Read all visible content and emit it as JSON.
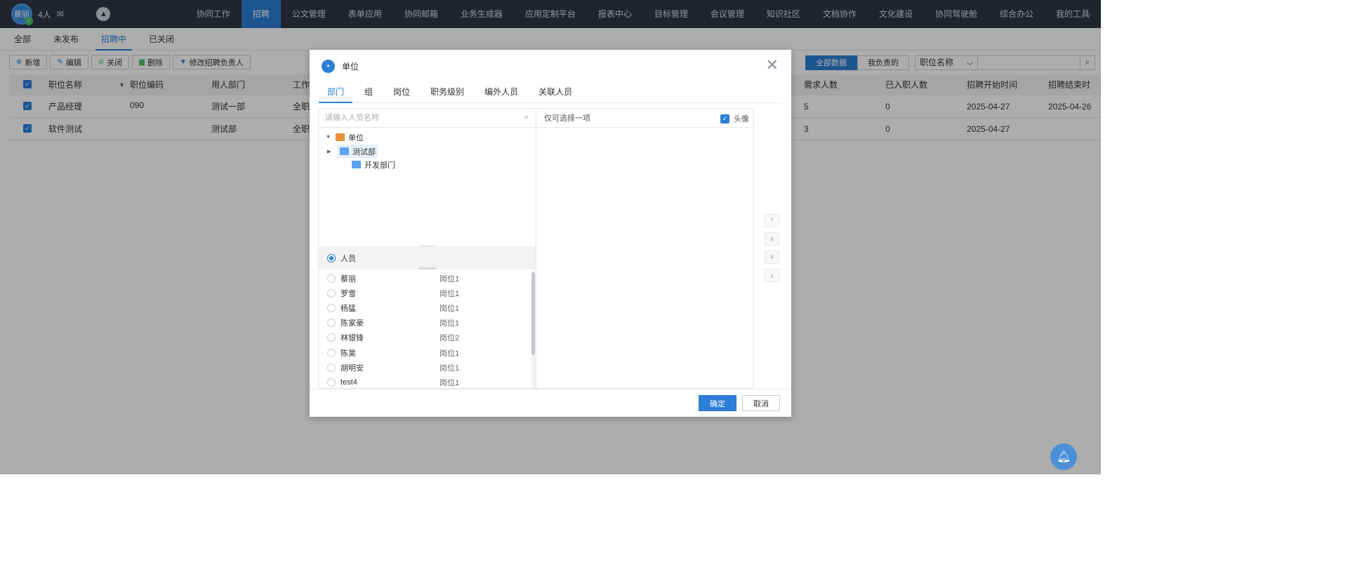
{
  "user": {
    "avatar_text": "蔡丽",
    "count": "4人",
    "mail_icon": "mail-icon"
  },
  "nav": {
    "items": [
      "协同工作",
      "招聘",
      "公文管理",
      "表单应用",
      "协同邮箱",
      "业务生成器",
      "应用定制平台",
      "报表中心",
      "目标管理",
      "会议管理",
      "知识社区",
      "文档协作",
      "文化建设",
      "协同驾驶舱",
      "综合办公",
      "我的工具"
    ],
    "active": "招聘"
  },
  "subtabs": {
    "items": [
      "全部",
      "未发布",
      "招聘中",
      "已关闭"
    ],
    "active": "招聘中"
  },
  "toolbar": {
    "add": "新增",
    "edit": "编辑",
    "close": "关闭",
    "delete": "删除",
    "change_owner": "修改招聘负责人",
    "all_data": "全部数据",
    "mine": "我负责的",
    "field_select": "职位名称",
    "search_value": ""
  },
  "table": {
    "headers": [
      "职位名称",
      "职位编码",
      "用人部门",
      "工作",
      "需求人数",
      "已入职人数",
      "招聘开始时间",
      "招聘结束时"
    ],
    "rows": [
      {
        "name": "产品经理",
        "code": "090",
        "dept": "测试一部",
        "work": "全职",
        "need": "5",
        "joined": "0",
        "start": "2025-04-27",
        "end": "2025-04-26"
      },
      {
        "name": "软件测试",
        "code": "",
        "dept": "测试部",
        "work": "全职",
        "need": "3",
        "joined": "0",
        "start": "2025-04-27",
        "end": ""
      }
    ]
  },
  "modal": {
    "title": "单位",
    "tabs": [
      "部门",
      "组",
      "岗位",
      "职务级别",
      "编外人员",
      "关联人员"
    ],
    "active_tab": "部门",
    "search_placeholder": "请输入人员名称",
    "tree": {
      "root": "单位",
      "children": [
        "测试部",
        "开发部门"
      ],
      "selected": "测试部"
    },
    "person_option": "人员",
    "people": [
      {
        "name": "蔡丽",
        "position": "岗位1"
      },
      {
        "name": "罗雪",
        "position": "岗位1"
      },
      {
        "name": "杨猛",
        "position": "岗位1"
      },
      {
        "name": "陈家豪",
        "position": "岗位1"
      },
      {
        "name": "林银锋",
        "position": "岗位2"
      },
      {
        "name": "陈昊",
        "position": "岗位1"
      },
      {
        "name": "胡明安",
        "position": "岗位1"
      },
      {
        "name": "test4",
        "position": "岗位1"
      }
    ],
    "right_hint": "仅可选择一项",
    "avatar_label": "头像",
    "avatar_checked": true,
    "ok": "确定",
    "cancel": "取消"
  },
  "colors": {
    "accent": "#2c7ed6",
    "nav_bg": "#2f3644"
  }
}
